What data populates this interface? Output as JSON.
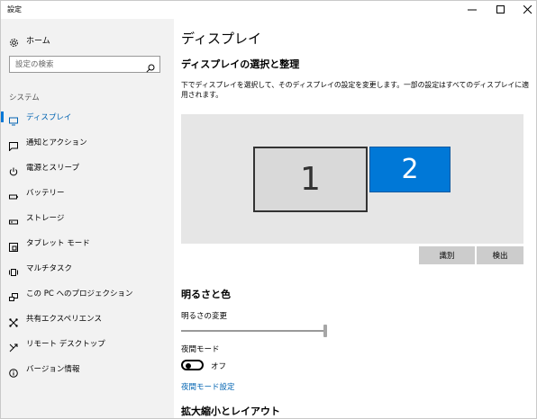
{
  "window": {
    "title": "設定"
  },
  "sidebar": {
    "home_label": "ホーム",
    "search_placeholder": "設定の検索",
    "section_label": "システム",
    "items": [
      {
        "label": "ディスプレイ",
        "icon": "monitor-icon",
        "active": true
      },
      {
        "label": "通知とアクション",
        "icon": "notification-icon"
      },
      {
        "label": "電源とスリープ",
        "icon": "power-icon"
      },
      {
        "label": "バッテリー",
        "icon": "battery-icon"
      },
      {
        "label": "ストレージ",
        "icon": "storage-icon"
      },
      {
        "label": "タブレット モード",
        "icon": "tablet-icon"
      },
      {
        "label": "マルチタスク",
        "icon": "multitask-icon"
      },
      {
        "label": "この PC へのプロジェクション",
        "icon": "projection-icon"
      },
      {
        "label": "共有エクスペリエンス",
        "icon": "shared-icon"
      },
      {
        "label": "リモート デスクトップ",
        "icon": "remote-desktop-icon"
      },
      {
        "label": "バージョン情報",
        "icon": "info-icon"
      }
    ]
  },
  "main": {
    "title": "ディスプレイ",
    "subtitle": "ディスプレイの選択と整理",
    "description": "下でディスプレイを選択して、そのディスプレイの設定を変更します。一部の設定はすべてのディスプレイに適用されます。",
    "monitors": [
      "1",
      "2"
    ],
    "identify_label": "識別",
    "detect_label": "検出",
    "brightness_heading": "明るさと色",
    "brightness_label": "明るさの変更",
    "brightness_value": 1.0,
    "night_mode_label": "夜間モード",
    "night_mode_state": "オフ",
    "night_mode_link": "夜間モード設定",
    "scale_heading": "拡大縮小とレイアウト"
  },
  "colors": {
    "accent": "#0078d7",
    "link": "#0063b1",
    "sidebar_bg": "#f2f2f2"
  }
}
